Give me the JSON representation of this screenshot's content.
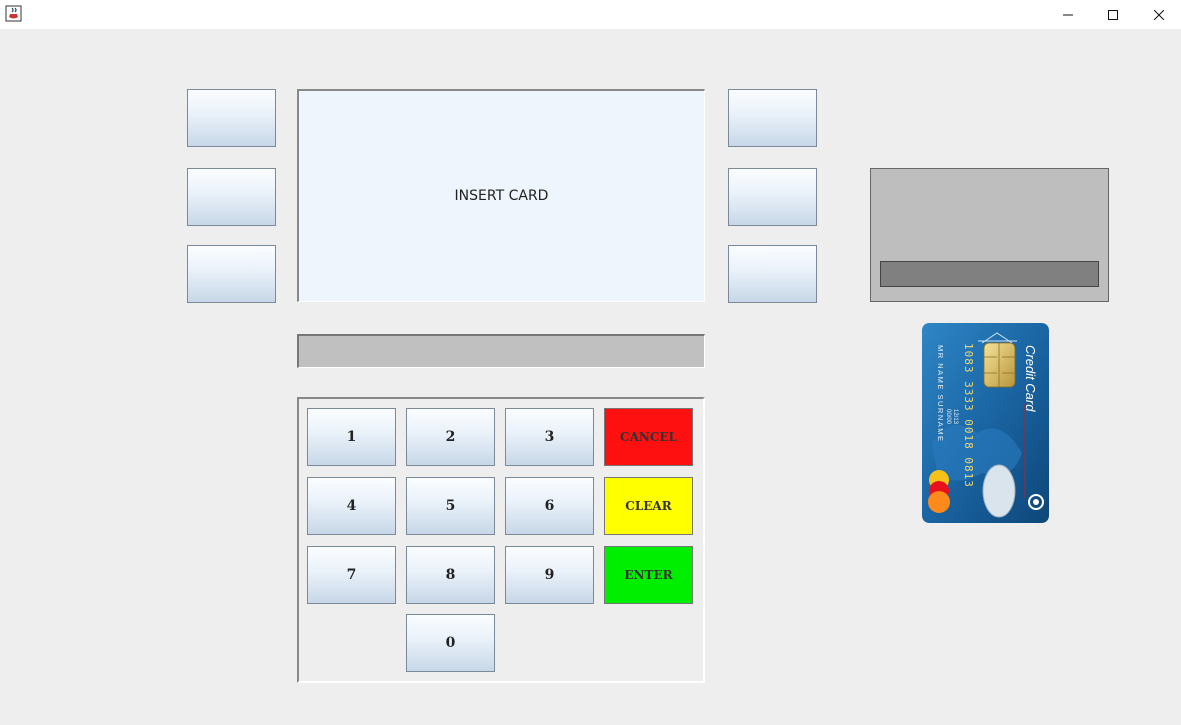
{
  "window": {
    "app_icon": "java-coffee-icon",
    "minimize_icon": "minimize-icon",
    "maximize_icon": "maximize-icon",
    "close_icon": "close-icon"
  },
  "screen": {
    "message": "INSERT CARD"
  },
  "keypad": {
    "keys": {
      "k1": "1",
      "k2": "2",
      "k3": "3",
      "k4": "4",
      "k5": "5",
      "k6": "6",
      "k7": "7",
      "k8": "8",
      "k9": "9",
      "k0": "0"
    },
    "cancel": "CANCEL",
    "clear": "CLEAR",
    "enter": "ENTER"
  },
  "card": {
    "brand": "Credit Card",
    "number": "1083 3333 0018 0813",
    "holder": "MR NAME SURNAME",
    "date_a": "00/00",
    "date_b": "12/13"
  },
  "colors": {
    "cancel": "#ff1010",
    "clear": "#ffff00",
    "enter": "#00ee00",
    "screen_bg": "#eef5fc",
    "card_blue": "#1f6fae"
  }
}
